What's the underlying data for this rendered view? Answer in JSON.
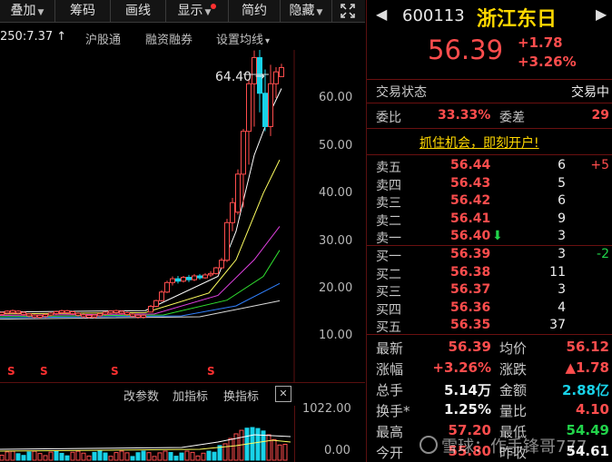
{
  "toolbar": {
    "items": [
      "叠加",
      "筹码",
      "画线",
      "显示",
      "简约",
      "隐藏"
    ],
    "expand_glyph": "⛶"
  },
  "infobar": {
    "ma": "250:7.37",
    "ma_arrow": "↑",
    "links": [
      "沪股通",
      "融资融券",
      "设置均线"
    ],
    "arrow": "▾"
  },
  "chart": {
    "price_axis": [
      "60.00",
      "50.00",
      "40.00",
      "30.00",
      "20.00",
      "10.00"
    ],
    "peak_label": "64.40",
    "peak_arrow": "→",
    "signal_marks": [
      "S",
      "S",
      "S",
      "S"
    ],
    "colors": {
      "up": "#ff4d4d",
      "down": "#18d2e8",
      "bg": "#000000"
    }
  },
  "subchart": {
    "buttons": [
      "改参数",
      "加指标",
      "换指标"
    ],
    "close": "✕",
    "vol_axis": [
      "1022.00",
      "0.00"
    ]
  },
  "quote": {
    "code": "600113",
    "name": "浙江东日",
    "price": "56.39",
    "change": "+1.78",
    "change_pct": "+3.26%",
    "prev_glyph": "◀",
    "next_glyph": "▶"
  },
  "status": {
    "label": "交易状态",
    "value": "交易中",
    "weibi_label": "委比",
    "weibi_value": "33.33%",
    "weicha_label": "委差",
    "weicha_value": "29",
    "promo": "抓住机会，即刻开户!"
  },
  "asks": [
    {
      "label": "卖五",
      "price": "56.44",
      "vol": "6",
      "chg": "+5"
    },
    {
      "label": "卖四",
      "price": "56.43",
      "vol": "5",
      "chg": ""
    },
    {
      "label": "卖三",
      "price": "56.42",
      "vol": "6",
      "chg": ""
    },
    {
      "label": "卖二",
      "price": "56.41",
      "vol": "9",
      "chg": ""
    },
    {
      "label": "卖一",
      "price": "56.40",
      "vol": "3",
      "chg": "",
      "arrow": "⬇"
    }
  ],
  "bids": [
    {
      "label": "买一",
      "price": "56.39",
      "vol": "3",
      "chg": "-2"
    },
    {
      "label": "买二",
      "price": "56.38",
      "vol": "11",
      "chg": ""
    },
    {
      "label": "买三",
      "price": "56.37",
      "vol": "3",
      "chg": ""
    },
    {
      "label": "买四",
      "price": "56.36",
      "vol": "4",
      "chg": ""
    },
    {
      "label": "买五",
      "price": "56.35",
      "vol": "37",
      "chg": ""
    }
  ],
  "stats": [
    {
      "l1": "最新",
      "v1": "56.39",
      "l2": "均价",
      "v2": "56.12"
    },
    {
      "l1": "涨幅",
      "v1": "+3.26%",
      "l2": "涨跌",
      "v2": "▲1.78"
    },
    {
      "l1": "总手",
      "v1": "5.14万",
      "l2": "金额",
      "v2": "2.88亿"
    },
    {
      "l1": "换手*",
      "v1": "1.25%",
      "l2": "量比",
      "v2": "4.10"
    },
    {
      "l1": "最高",
      "v1": "57.20",
      "l2": "最低",
      "v2": "54.49"
    },
    {
      "l1": "今开",
      "v1": "55.80",
      "l2": "昨收",
      "v2": "54.61"
    }
  ],
  "watermark": "雪球：作手锋哥777"
}
